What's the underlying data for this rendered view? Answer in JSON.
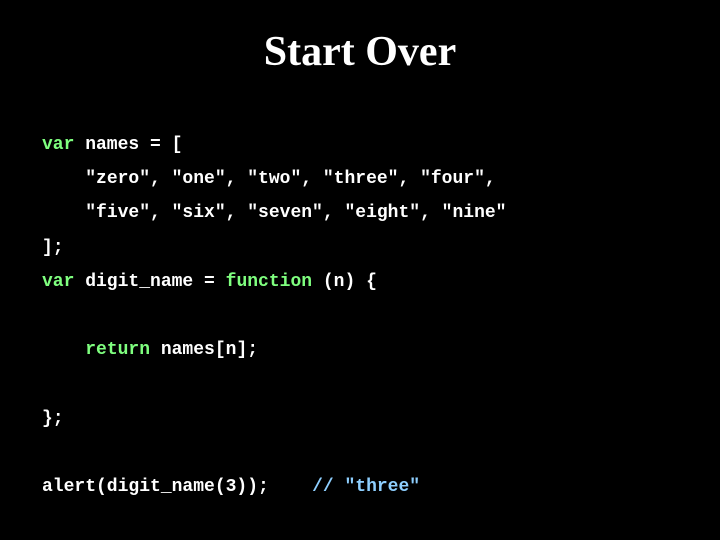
{
  "title": "Start Over",
  "code": {
    "l1_kw": "var",
    "l1_rest": " names = [",
    "l2": "\"zero\", \"one\", \"two\", \"three\", \"four\",",
    "l3": "\"five\", \"six\", \"seven\", \"eight\", \"nine\"",
    "l4": "];",
    "l5_kw1": "var",
    "l5_mid": " digit_name = ",
    "l5_kw2": "function",
    "l5_rest": " (n) {",
    "l6_kw": "return",
    "l6_rest": " names[n];",
    "l7": "};",
    "l8_call": "alert(digit_name(3));",
    "l8_gap": "    ",
    "l8_com": "// \"three\""
  }
}
